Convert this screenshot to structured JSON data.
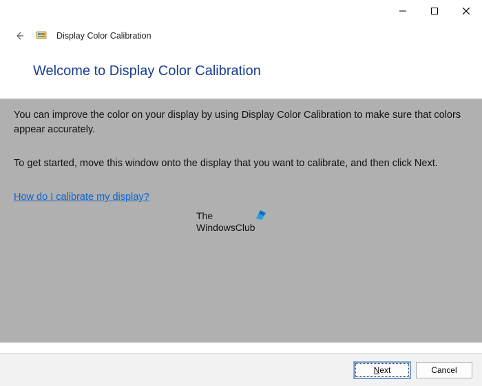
{
  "window": {
    "title": "Display Color Calibration"
  },
  "buttons": {
    "minimize": "Minimize",
    "maximize": "Maximize",
    "close": "Close",
    "back": "Back",
    "next": "Next",
    "cancel": "Cancel"
  },
  "page": {
    "heading": "Welcome to Display Color Calibration",
    "para1": "You can improve the color on your display by using Display Color Calibration to make sure that colors appear accurately.",
    "para2": "To get started, move this window onto the display that you want to calibrate, and then click Next.",
    "help_link": "How do I calibrate my display?"
  },
  "watermark": {
    "line1": "The",
    "line2": "WindowsClub"
  }
}
